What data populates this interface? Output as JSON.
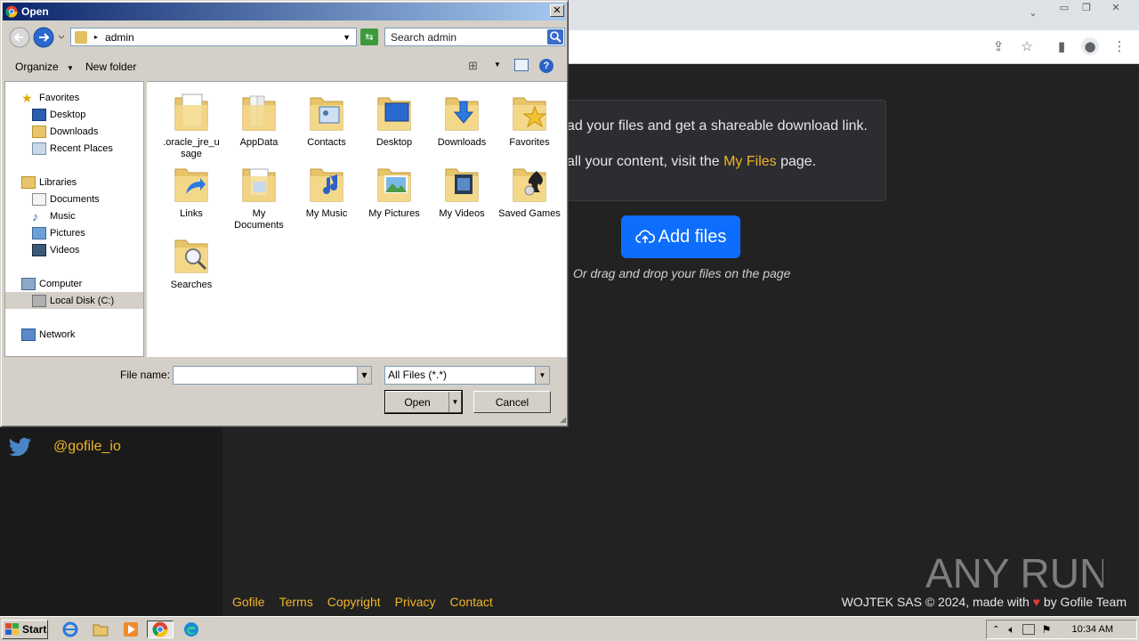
{
  "dialog": {
    "title": "Open",
    "address": "admin",
    "search_placeholder": "Search admin",
    "organize_label": "Organize",
    "new_folder_label": "New folder",
    "nav": {
      "favorites": "Favorites",
      "desktop": "Desktop",
      "downloads": "Downloads",
      "recent_places": "Recent Places",
      "libraries": "Libraries",
      "documents": "Documents",
      "music": "Music",
      "pictures": "Pictures",
      "videos": "Videos",
      "computer": "Computer",
      "local_disk": "Local Disk (C:)",
      "network": "Network"
    },
    "files": [
      {
        "label": ".oracle_jre_u sage",
        "icon": "folder-document-icon"
      },
      {
        "label": "AppData",
        "icon": "folder-icon"
      },
      {
        "label": "Contacts",
        "icon": "folder-contacts-icon"
      },
      {
        "label": "Desktop",
        "icon": "folder-desktop-icon"
      },
      {
        "label": "Downloads",
        "icon": "folder-downloads-icon"
      },
      {
        "label": "Favorites",
        "icon": "folder-favorites-icon"
      },
      {
        "label": "Links",
        "icon": "folder-links-icon"
      },
      {
        "label": "My Documents",
        "icon": "folder-documents-icon"
      },
      {
        "label": "My Music",
        "icon": "folder-music-icon"
      },
      {
        "label": "My Pictures",
        "icon": "folder-pictures-icon"
      },
      {
        "label": "My Videos",
        "icon": "folder-videos-icon"
      },
      {
        "label": "Saved Games",
        "icon": "folder-games-icon"
      },
      {
        "label": "Searches",
        "icon": "folder-search-icon"
      }
    ],
    "file_name_label": "File name:",
    "file_name_value": "",
    "file_type": "All Files (*.*)",
    "open_label": "Open",
    "cancel_label": "Cancel"
  },
  "page": {
    "info_line1": "ad your files and get a shareable download link.",
    "info_line2_prefix": "all your content, visit the ",
    "info_line2_link": "My Files",
    "info_line2_suffix": " page.",
    "add_files_label": "Add files",
    "drag_hint": "Or drag and drop your files on the page",
    "twitter_handle": "@gofile_io",
    "footer_links": [
      "Gofile",
      "Terms",
      "Copyright",
      "Privacy",
      "Contact"
    ],
    "footer_prefix": "WOJTEK SAS © 2024, made with ",
    "footer_suffix": " by Gofile Team",
    "watermark": "ANY RUN"
  },
  "taskbar": {
    "start_label": "Start",
    "clock": "10:34 AM"
  },
  "colors": {
    "accent_yellow": "#f0b429",
    "button_blue": "#0d6efd",
    "titlebar_start": "#0a246a",
    "titlebar_end": "#a6caf0"
  }
}
